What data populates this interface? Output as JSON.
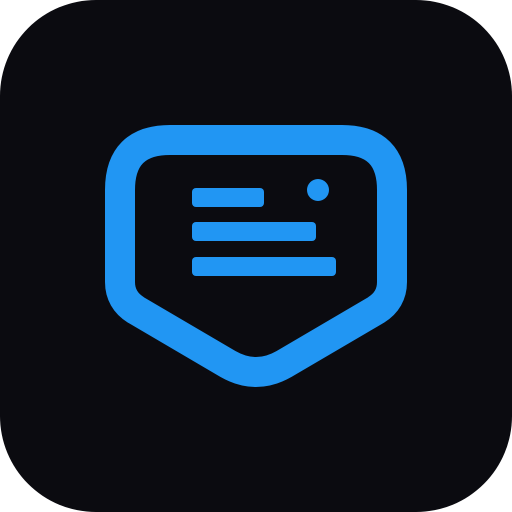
{
  "app_icon": {
    "icon": "tag-with-text-lines-icon",
    "colors": {
      "tile_background": "#0B0B10",
      "accent": "#2196F3",
      "page_background": "#FFFFFF"
    }
  }
}
